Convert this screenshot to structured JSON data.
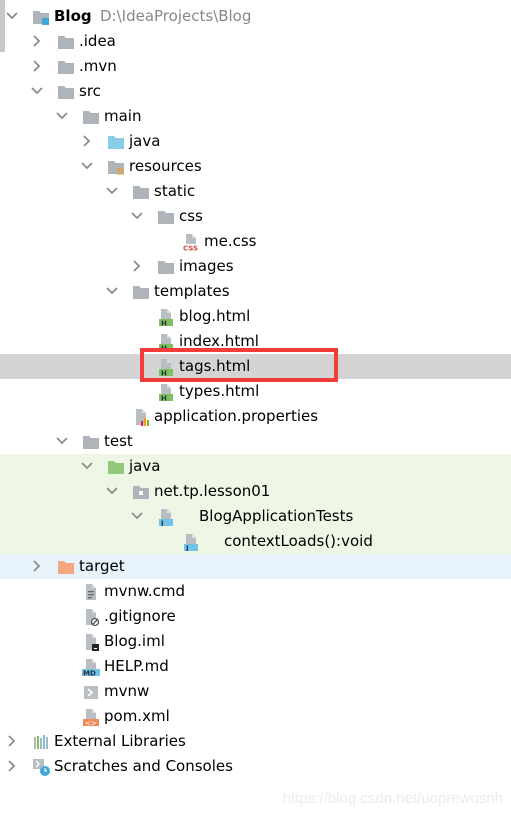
{
  "colors": {
    "folder": "#aeb4b9",
    "source_folder": "#89cde8",
    "test_folder": "#94c97c",
    "excluded_folder": "#f4a582",
    "selection": "#d4d4d4",
    "highlight_box": "#f23c3c",
    "test_bg": "#eef7e5",
    "target_bg": "#e8f2fb"
  },
  "tree": [
    {
      "label": "Blog",
      "path": "D:\\IdeaProjects\\Blog",
      "depth": 0,
      "state": "expanded",
      "icon": "module-folder-icon",
      "bold": true
    },
    {
      "label": ".idea",
      "depth": 1,
      "state": "collapsed",
      "icon": "folder-icon"
    },
    {
      "label": ".mvn",
      "depth": 1,
      "state": "collapsed",
      "icon": "folder-icon"
    },
    {
      "label": "src",
      "depth": 1,
      "state": "expanded",
      "icon": "folder-icon"
    },
    {
      "label": "main",
      "depth": 2,
      "state": "expanded",
      "icon": "folder-icon"
    },
    {
      "label": "java",
      "depth": 3,
      "state": "collapsed",
      "icon": "source-folder-icon"
    },
    {
      "label": "resources",
      "depth": 3,
      "state": "expanded",
      "icon": "resources-folder-icon"
    },
    {
      "label": "static",
      "depth": 4,
      "state": "expanded",
      "icon": "folder-icon"
    },
    {
      "label": "css",
      "depth": 5,
      "state": "expanded",
      "icon": "folder-icon"
    },
    {
      "label": "me.css",
      "depth": 6,
      "state": "leaf",
      "icon": "css-file-icon"
    },
    {
      "label": "images",
      "depth": 5,
      "state": "collapsed",
      "icon": "folder-icon"
    },
    {
      "label": "templates",
      "depth": 4,
      "state": "expanded",
      "icon": "folder-icon"
    },
    {
      "label": "blog.html",
      "depth": 5,
      "state": "leaf",
      "icon": "html-file-icon"
    },
    {
      "label": "index.html",
      "depth": 5,
      "state": "leaf",
      "icon": "html-file-icon"
    },
    {
      "label": "tags.html",
      "depth": 5,
      "state": "leaf",
      "icon": "html-file-icon",
      "selected": true
    },
    {
      "label": "types.html",
      "depth": 5,
      "state": "leaf",
      "icon": "html-file-icon"
    },
    {
      "label": "application.properties",
      "depth": 4,
      "state": "leaf",
      "icon": "properties-file-icon"
    },
    {
      "label": "test",
      "depth": 2,
      "state": "expanded",
      "icon": "folder-icon"
    },
    {
      "label": "java",
      "depth": 3,
      "state": "expanded",
      "icon": "test-folder-icon",
      "bg": "green"
    },
    {
      "label": "net.tp.lesson01",
      "depth": 4,
      "state": "expanded",
      "icon": "package-icon",
      "bg": "green"
    },
    {
      "label": "BlogApplicationTests",
      "depth": 5,
      "state": "expanded",
      "icon": "java-class-icon",
      "bg": "green",
      "gap": true
    },
    {
      "label": "contextLoads():void",
      "depth": 6,
      "state": "leaf",
      "icon": "java-class-icon",
      "bg": "green",
      "gap": true
    },
    {
      "label": "target",
      "depth": 1,
      "state": "collapsed",
      "icon": "excluded-folder-icon",
      "bg": "blue"
    },
    {
      "label": "mvnw.cmd",
      "depth": 2,
      "state": "leaf",
      "icon": "text-file-icon"
    },
    {
      "label": ".gitignore",
      "depth": 2,
      "state": "leaf",
      "icon": "ignore-file-icon"
    },
    {
      "label": "Blog.iml",
      "depth": 2,
      "state": "leaf",
      "icon": "iml-file-icon"
    },
    {
      "label": "HELP.md",
      "depth": 2,
      "state": "leaf",
      "icon": "markdown-file-icon"
    },
    {
      "label": "mvnw",
      "depth": 2,
      "state": "leaf",
      "icon": "shell-file-icon"
    },
    {
      "label": "pom.xml",
      "depth": 2,
      "state": "leaf",
      "icon": "xml-file-icon"
    },
    {
      "label": "External Libraries",
      "depth": 0,
      "state": "collapsed",
      "icon": "libraries-icon"
    },
    {
      "label": "Scratches and Consoles",
      "depth": 0,
      "state": "collapsed",
      "icon": "scratches-icon"
    }
  ],
  "watermark": "https://blog.csdn.net/uoprewqsnh"
}
